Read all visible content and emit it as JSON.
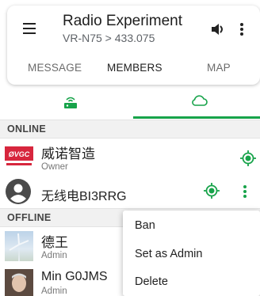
{
  "header": {
    "title": "Radio Experiment",
    "subtitle": "VR-N75 > 433.075",
    "menu_icon": "hamburger-menu-icon",
    "volume_icon": "volume-icon",
    "more_icon": "more-vertical-icon"
  },
  "tabs": [
    {
      "label": "MESSAGE",
      "active": false
    },
    {
      "label": "MEMBERS",
      "active": true
    },
    {
      "label": "MAP",
      "active": false
    }
  ],
  "subtabs": [
    {
      "icon": "router-icon",
      "active": false
    },
    {
      "icon": "cloud-icon",
      "active": true
    }
  ],
  "sections": {
    "online": "ONLINE",
    "offline": "OFFLINE"
  },
  "members": [
    {
      "name": "威诺智造",
      "role": "Owner",
      "avatar": "vgc-logo",
      "status": "online"
    },
    {
      "name": "无线电BI3RRG",
      "role": "",
      "avatar": "default-person-icon",
      "status": "online"
    },
    {
      "name": "德王",
      "role": "Admin",
      "avatar": "wind-turbine-photo",
      "status": "offline"
    },
    {
      "name": "Min G0JMS",
      "role": "Admin",
      "avatar": "person-photo",
      "status": "offline"
    }
  ],
  "context_menu": {
    "items": [
      "Ban",
      "Set as Admin",
      "Delete"
    ]
  },
  "colors": {
    "accent": "#17a34a",
    "logo_red": "#d7263d"
  }
}
